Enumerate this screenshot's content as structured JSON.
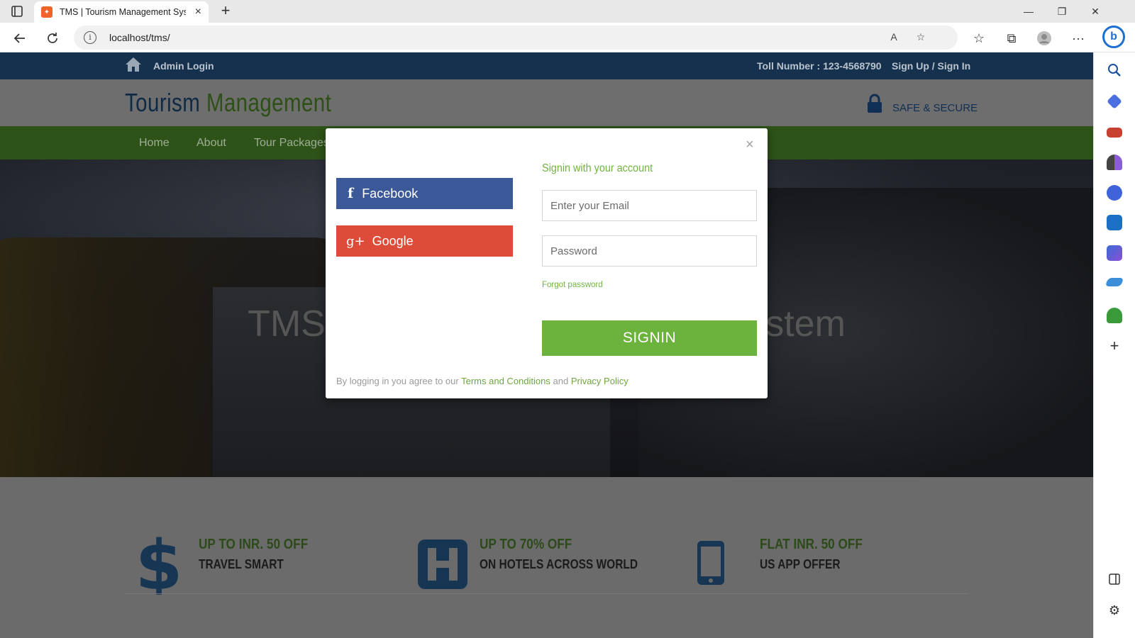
{
  "browser": {
    "tab_title": "TMS | Tourism Management System",
    "tab_close": "×",
    "new_tab": "+",
    "url": "localhost/tms/",
    "win_minimize": "—",
    "win_restore": "❐",
    "win_close": "✕",
    "more": "···"
  },
  "topbar": {
    "admin_login": "Admin Login",
    "toll": "Toll Number : 123-4568790",
    "signup": "Sign Up / Sign In"
  },
  "header": {
    "brand_part1": "Tourism",
    "brand_part2": "Management",
    "secure": "SAFE & SECURE"
  },
  "nav": {
    "items": [
      "Home",
      "About",
      "Tour Packages"
    ]
  },
  "hero": {
    "title": "TMS - Tourism Management System"
  },
  "offers": [
    {
      "icon": "dollar-icon",
      "head": "UP TO INR. 50 OFF",
      "sub": "TRAVEL SMART"
    },
    {
      "icon": "hotel-icon",
      "head": "UP TO 70% OFF",
      "sub": "ON HOTELS ACROSS WORLD"
    },
    {
      "icon": "mobile-icon",
      "head": "FLAT INR. 50 OFF",
      "sub": "US APP OFFER"
    }
  ],
  "modal": {
    "close": "×",
    "facebook_glyph": "f",
    "facebook": "Facebook",
    "google_glyph": "g+",
    "google": "Google",
    "heading": "Signin with your account",
    "email_placeholder": "Enter your Email",
    "password_placeholder": "Password",
    "forgot": "Forgot password",
    "signin": "SIGNIN",
    "legal_prefix": "By logging in you agree to our",
    "terms": "Terms and Conditions",
    "legal_and": "and",
    "privacy": "Privacy Policy"
  },
  "colors": {
    "facebook": "#3b5998",
    "google": "#dd4b39",
    "signin": "#6bb33c",
    "accent_green": "#6fb43f",
    "topstrip": "#16314d"
  }
}
